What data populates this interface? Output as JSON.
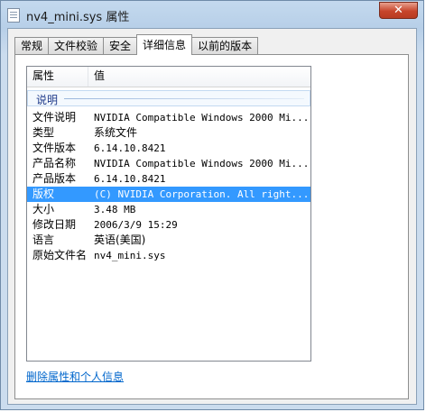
{
  "window": {
    "title": "nv4_mini.sys 属性",
    "close_label": "✕"
  },
  "tabs": [
    {
      "label": "常规"
    },
    {
      "label": "文件校验"
    },
    {
      "label": "安全"
    },
    {
      "label": "详细信息",
      "active": true
    },
    {
      "label": "以前的版本"
    }
  ],
  "details": {
    "columns": [
      "属性",
      "值"
    ],
    "group_label": "说明",
    "rows": [
      {
        "key": "文件说明",
        "value": "NVIDIA Compatible Windows 2000 Mi..."
      },
      {
        "key": "类型",
        "value": "系统文件"
      },
      {
        "key": "文件版本",
        "value": "6.14.10.8421"
      },
      {
        "key": "产品名称",
        "value": "NVIDIA Compatible Windows 2000 Mi..."
      },
      {
        "key": "产品版本",
        "value": "6.14.10.8421"
      },
      {
        "key": "版权",
        "value": "(C) NVIDIA Corporation. All right...",
        "selected": true
      },
      {
        "key": "大小",
        "value": "3.48 MB"
      },
      {
        "key": "修改日期",
        "value": "2006/3/9 15:29"
      },
      {
        "key": "语言",
        "value": "英语(美国)"
      },
      {
        "key": "原始文件名",
        "value": "nv4_mini.sys"
      }
    ]
  },
  "remove_link": "删除属性和个人信息",
  "colors": {
    "selection": "#3399ff",
    "link": "#0066cc",
    "close_button": "#c7452b"
  }
}
